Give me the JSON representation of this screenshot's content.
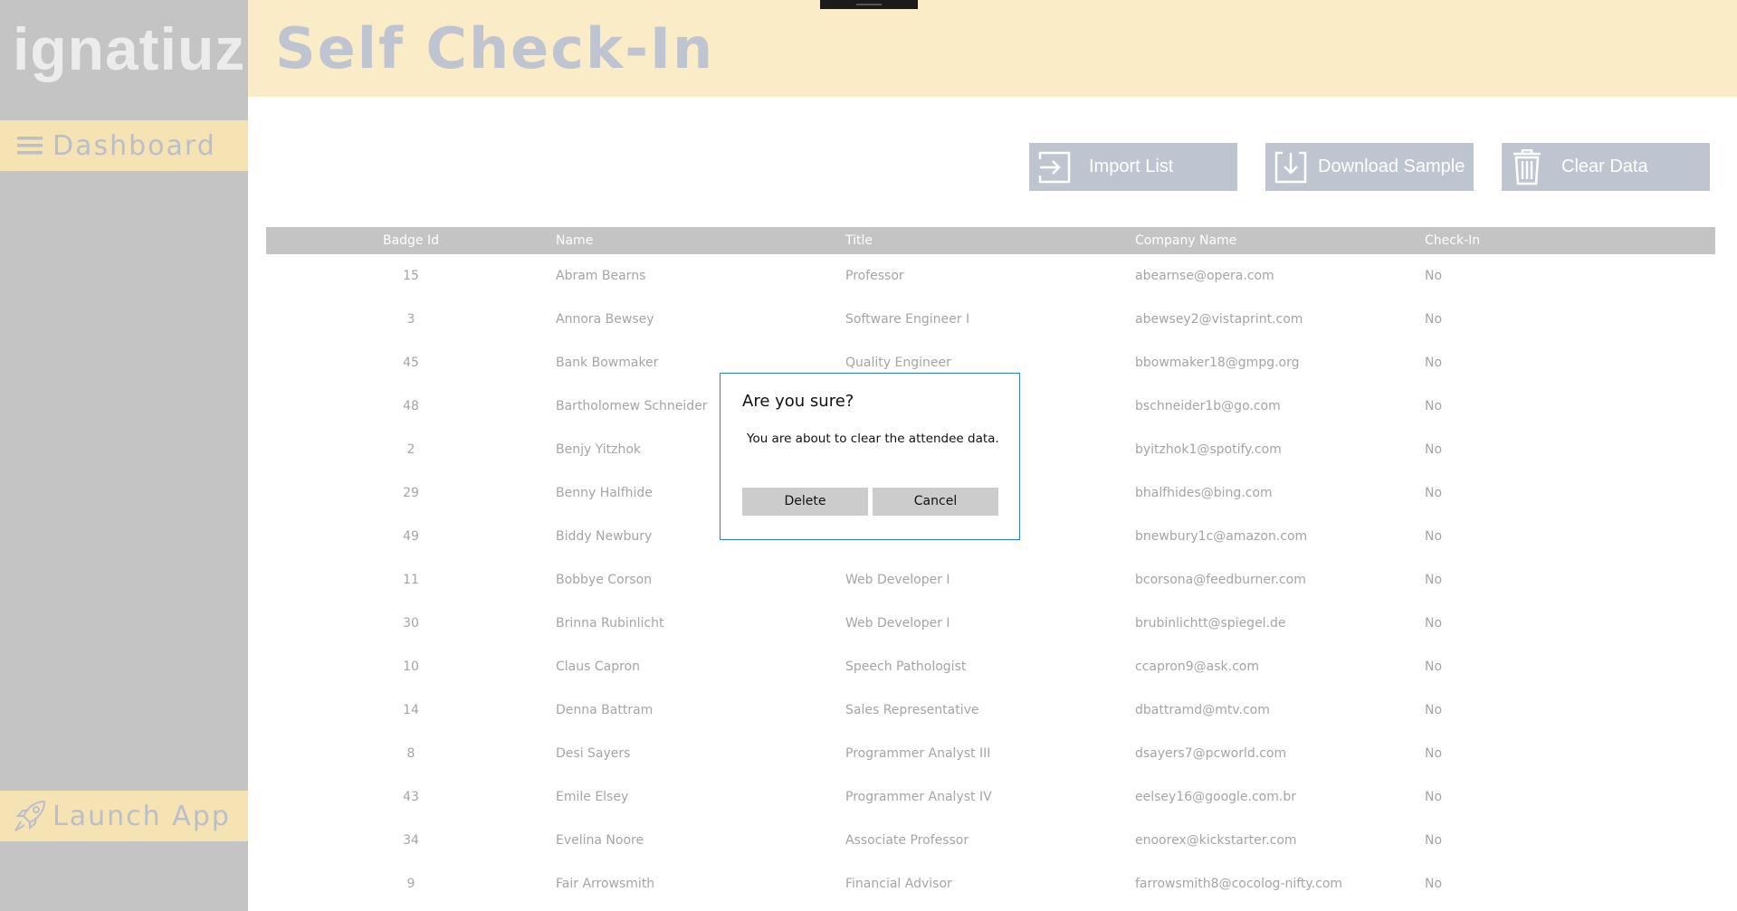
{
  "sidebar": {
    "logo": "ignatiuz",
    "dashboard_label": "Dashboard",
    "launch_label": "Launch App"
  },
  "header": {
    "title": "Self Check-In"
  },
  "toolbar": {
    "import_label": "Import List",
    "download_label": "Download Sample",
    "clear_label": "Clear Data"
  },
  "table": {
    "columns": [
      "Badge Id",
      "Name",
      "Title",
      "Company Name",
      "Check-In"
    ],
    "rows": [
      {
        "badge": "15",
        "name": "Abram Bearns",
        "title": "Professor",
        "company": "abearnse@opera.com",
        "checkin": "No"
      },
      {
        "badge": "3",
        "name": "Annora Bewsey",
        "title": "Software Engineer I",
        "company": "abewsey2@vistaprint.com",
        "checkin": "No"
      },
      {
        "badge": "45",
        "name": "Bank Bowmaker",
        "title": "Quality Engineer",
        "company": "bbowmaker18@gmpg.org",
        "checkin": "No"
      },
      {
        "badge": "48",
        "name": "Bartholomew Schneider",
        "title": "",
        "company": "bschneider1b@go.com",
        "checkin": "No"
      },
      {
        "badge": "2",
        "name": "Benjy Yitzhok",
        "title": "",
        "company": "byitzhok1@spotify.com",
        "checkin": "No"
      },
      {
        "badge": "29",
        "name": "Benny Halfhide",
        "title": "",
        "company": "bhalfhides@bing.com",
        "checkin": "No"
      },
      {
        "badge": "49",
        "name": "Biddy Newbury",
        "title": "",
        "company": "bnewbury1c@amazon.com",
        "checkin": "No"
      },
      {
        "badge": "11",
        "name": "Bobbye Corson",
        "title": "Web Developer I",
        "company": "bcorsona@feedburner.com",
        "checkin": "No"
      },
      {
        "badge": "30",
        "name": "Brinna Rubinlicht",
        "title": "Web Developer I",
        "company": "brubinlichtt@spiegel.de",
        "checkin": "No"
      },
      {
        "badge": "10",
        "name": "Claus Capron",
        "title": "Speech Pathologist",
        "company": "ccapron9@ask.com",
        "checkin": "No"
      },
      {
        "badge": "14",
        "name": "Denna Battram",
        "title": "Sales Representative",
        "company": "dbattramd@mtv.com",
        "checkin": "No"
      },
      {
        "badge": "8",
        "name": "Desi Sayers",
        "title": "Programmer Analyst III",
        "company": "dsayers7@pcworld.com",
        "checkin": "No"
      },
      {
        "badge": "43",
        "name": "Emile Elsey",
        "title": "Programmer Analyst IV",
        "company": "eelsey16@google.com.br",
        "checkin": "No"
      },
      {
        "badge": "34",
        "name": "Evelina Noore",
        "title": "Associate Professor",
        "company": "enoorex@kickstarter.com",
        "checkin": "No"
      },
      {
        "badge": "9",
        "name": "Fair Arrowsmith",
        "title": "Financial Advisor",
        "company": "farrowsmith8@cocolog-nifty.com",
        "checkin": "No"
      }
    ]
  },
  "dialog": {
    "title": "Are you sure?",
    "message": "You are about to clear the attendee data.",
    "delete_label": "Delete",
    "cancel_label": "Cancel"
  },
  "icons": {
    "menu": "hamburger-icon",
    "launch": "rocket-icon",
    "import": "import-arrow-icon",
    "download": "download-arrow-icon",
    "clear": "trash-icon"
  },
  "colors": {
    "sidebar_bg": "#c4c4c4",
    "header_bg": "#fbecc8",
    "nav_highlight": "#f6e3b4",
    "button_bg": "#bec4d0",
    "dialog_border": "#2b7fd0"
  }
}
